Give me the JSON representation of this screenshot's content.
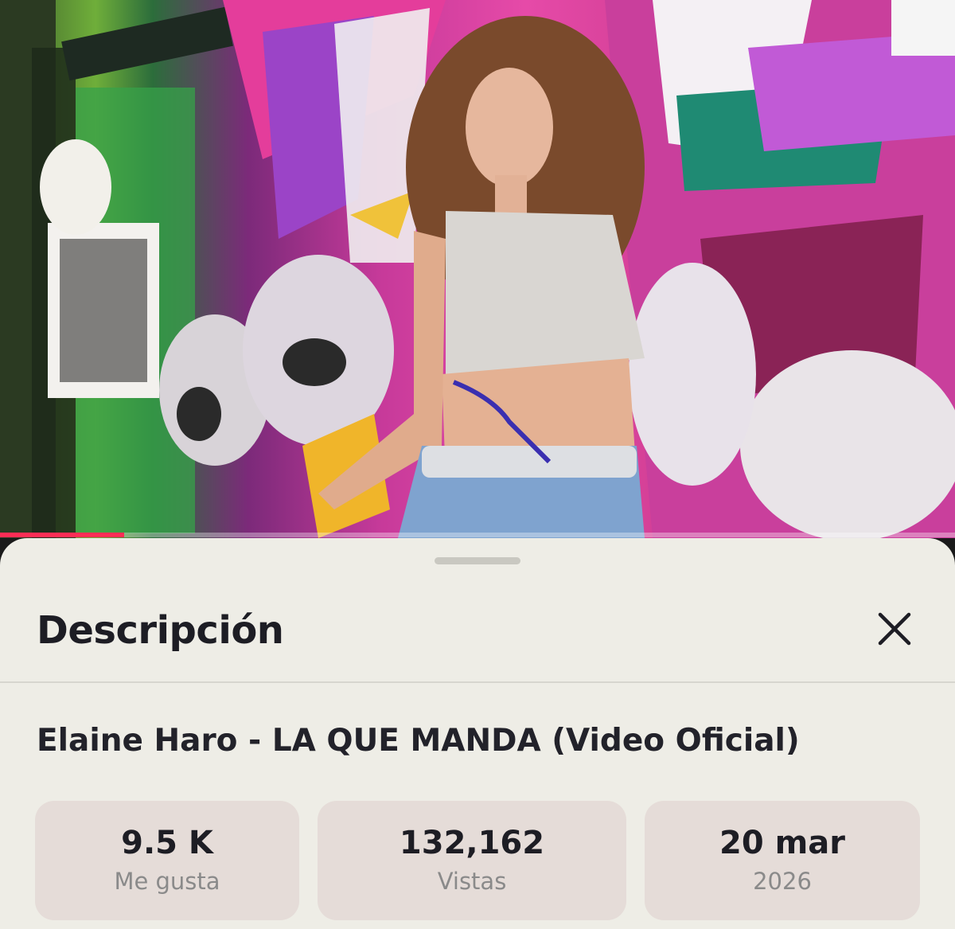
{
  "player": {
    "progress_fraction": 0.13,
    "accent_color": "#ff2d55"
  },
  "sheet": {
    "title": "Descripción",
    "close_icon": "close-icon",
    "video_title": "Elaine Haro - LA QUE MANDA (Video Oficial)",
    "stats": [
      {
        "value": "9.5 K",
        "label": "Me gusta"
      },
      {
        "value": "132,162",
        "label": "Vistas"
      },
      {
        "value": "20 mar",
        "label": "2026"
      }
    ]
  }
}
